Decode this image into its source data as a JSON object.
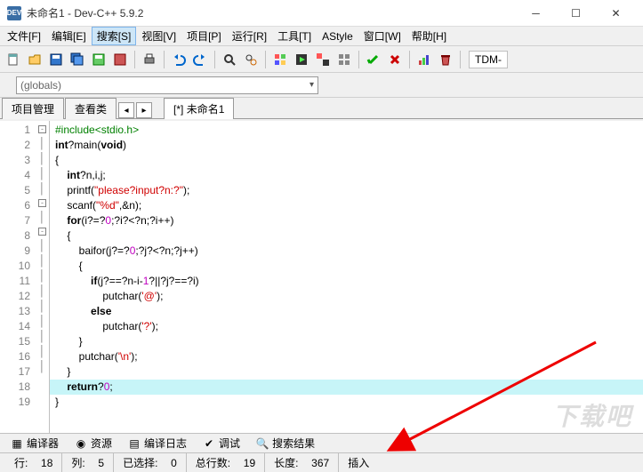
{
  "window": {
    "title": "未命名1 - Dev-C++ 5.9.2",
    "app_icon_label": "DEV"
  },
  "menu": {
    "items": [
      "文件[F]",
      "编辑[E]",
      "搜索[S]",
      "视图[V]",
      "项目[P]",
      "运行[R]",
      "工具[T]",
      "AStyle",
      "窗口[W]",
      "帮助[H]"
    ],
    "active_index": 2
  },
  "toolbar_right_label": "TDM-",
  "scope_combo": {
    "value": "(globals)"
  },
  "side_tabs": {
    "items": [
      "项目管理",
      "查看类"
    ]
  },
  "editor_tabs": {
    "items": [
      "[*] 未命名1"
    ]
  },
  "code": {
    "lines": [
      {
        "n": 1,
        "html": "<span class='pp'>#include&lt;stdio.h&gt;</span>"
      },
      {
        "n": 2,
        "html": "<span class='kw'>int</span>?main(<span class='kw'>void</span>)"
      },
      {
        "n": 3,
        "html": "{",
        "fold": "box"
      },
      {
        "n": 4,
        "html": "    <span class='kw'>int</span>?n,i,j;"
      },
      {
        "n": 5,
        "html": "    printf(<span class='str'>\"please?input?n:?\"</span>);"
      },
      {
        "n": 6,
        "html": "    scanf(<span class='str'>\"%d\"</span>,&amp;n);"
      },
      {
        "n": 7,
        "html": "    <span class='kw'>for</span>(i?=?<span class='num'>0</span>;?i?&lt;?n;?i++)"
      },
      {
        "n": 8,
        "html": "    {",
        "fold": "box"
      },
      {
        "n": 9,
        "html": "        baifor(j?=?<span class='num'>0</span>;?j?&lt;?n;?j++)"
      },
      {
        "n": 10,
        "html": "        {",
        "fold": "box"
      },
      {
        "n": 11,
        "html": "            <span class='kw'>if</span>(j?==?n-i-<span class='num'>1</span>?||?j?==?i)"
      },
      {
        "n": 12,
        "html": "                putchar(<span class='str'>'@'</span>);"
      },
      {
        "n": 13,
        "html": "            <span class='kw'>else</span>"
      },
      {
        "n": 14,
        "html": "                putchar(<span class='str'>'?'</span>);"
      },
      {
        "n": 15,
        "html": "        }"
      },
      {
        "n": 16,
        "html": "        putchar(<span class='str'>'\\n'</span>);"
      },
      {
        "n": 17,
        "html": "    }"
      },
      {
        "n": 18,
        "html": "    <span class='kw'>return</span>?<span class='num'>0</span>;",
        "highlight": true
      },
      {
        "n": 19,
        "html": "}"
      }
    ]
  },
  "bottom_tabs": {
    "items": [
      {
        "icon": "grid",
        "label": "编译器"
      },
      {
        "icon": "disk",
        "label": "资源"
      },
      {
        "icon": "log",
        "label": "编译日志"
      },
      {
        "icon": "check",
        "label": "调试"
      },
      {
        "icon": "search",
        "label": "搜索结果"
      }
    ]
  },
  "status": {
    "row_label": "行:",
    "row_val": "18",
    "col_label": "列:",
    "col_val": "5",
    "sel_label": "已选择:",
    "sel_val": "0",
    "total_label": "总行数:",
    "total_val": "19",
    "len_label": "长度:",
    "len_val": "367",
    "mode": "插入"
  },
  "watermark": "下载吧"
}
